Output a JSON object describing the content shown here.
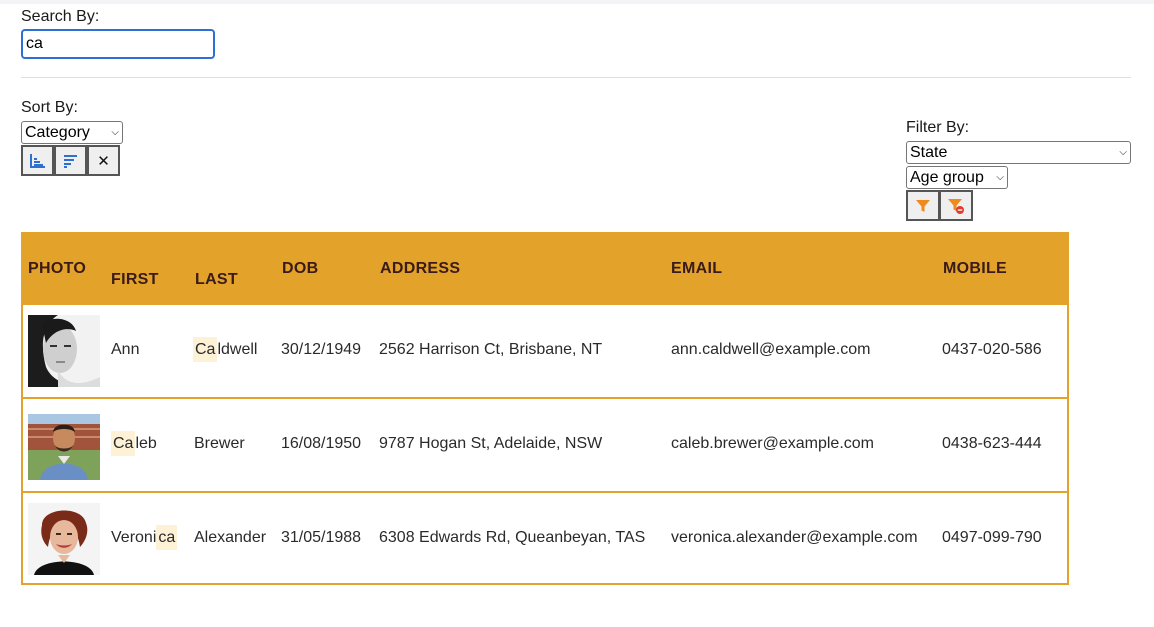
{
  "search": {
    "label": "Search By:",
    "value": "ca"
  },
  "sort": {
    "label": "Sort By:",
    "selected": "Category",
    "buttons": [
      "sort-ascending-icon",
      "sort-descending-icon",
      "clear-icon"
    ],
    "clear_glyph": "✕"
  },
  "filter": {
    "label": "Filter By:",
    "state_selected": "State",
    "age_selected": "Age group",
    "buttons": [
      "filter-icon",
      "filter-clear-icon"
    ]
  },
  "colors": {
    "accent": "#e3a32a",
    "highlight": "#fdf1d6",
    "header_text": "#3a1a1a"
  },
  "table": {
    "headers": {
      "photo": "PHOTO",
      "first": "FIRST",
      "last": "LAST",
      "dob": "DOB",
      "address": "ADDRESS",
      "email": "EMAIL",
      "mobile": "MOBILE"
    },
    "rows": [
      {
        "first_pre": "",
        "first_hl": "",
        "first_post": "Ann",
        "last_pre": "",
        "last_hl": "Ca",
        "last_post": "ldwell",
        "dob": "30/12/1949",
        "address": "2562 Harrison Ct, Brisbane, NT",
        "email": "ann.caldwell@example.com",
        "mobile": "0437-020-586"
      },
      {
        "first_pre": "",
        "first_hl": "Ca",
        "first_post": "leb",
        "last_pre": "",
        "last_hl": "",
        "last_post": "Brewer",
        "dob": "16/08/1950",
        "address": "9787 Hogan St, Adelaide, NSW",
        "email": "caleb.brewer@example.com",
        "mobile": "0438-623-444"
      },
      {
        "first_pre": "Veroni",
        "first_hl": "ca",
        "first_post": "",
        "last_pre": "",
        "last_hl": "",
        "last_post": "Alexander",
        "dob": "31/05/1988",
        "address": "6308 Edwards Rd, Queanbeyan, TAS",
        "email": "veronica.alexander@example.com",
        "mobile": "0497-099-790"
      }
    ]
  }
}
